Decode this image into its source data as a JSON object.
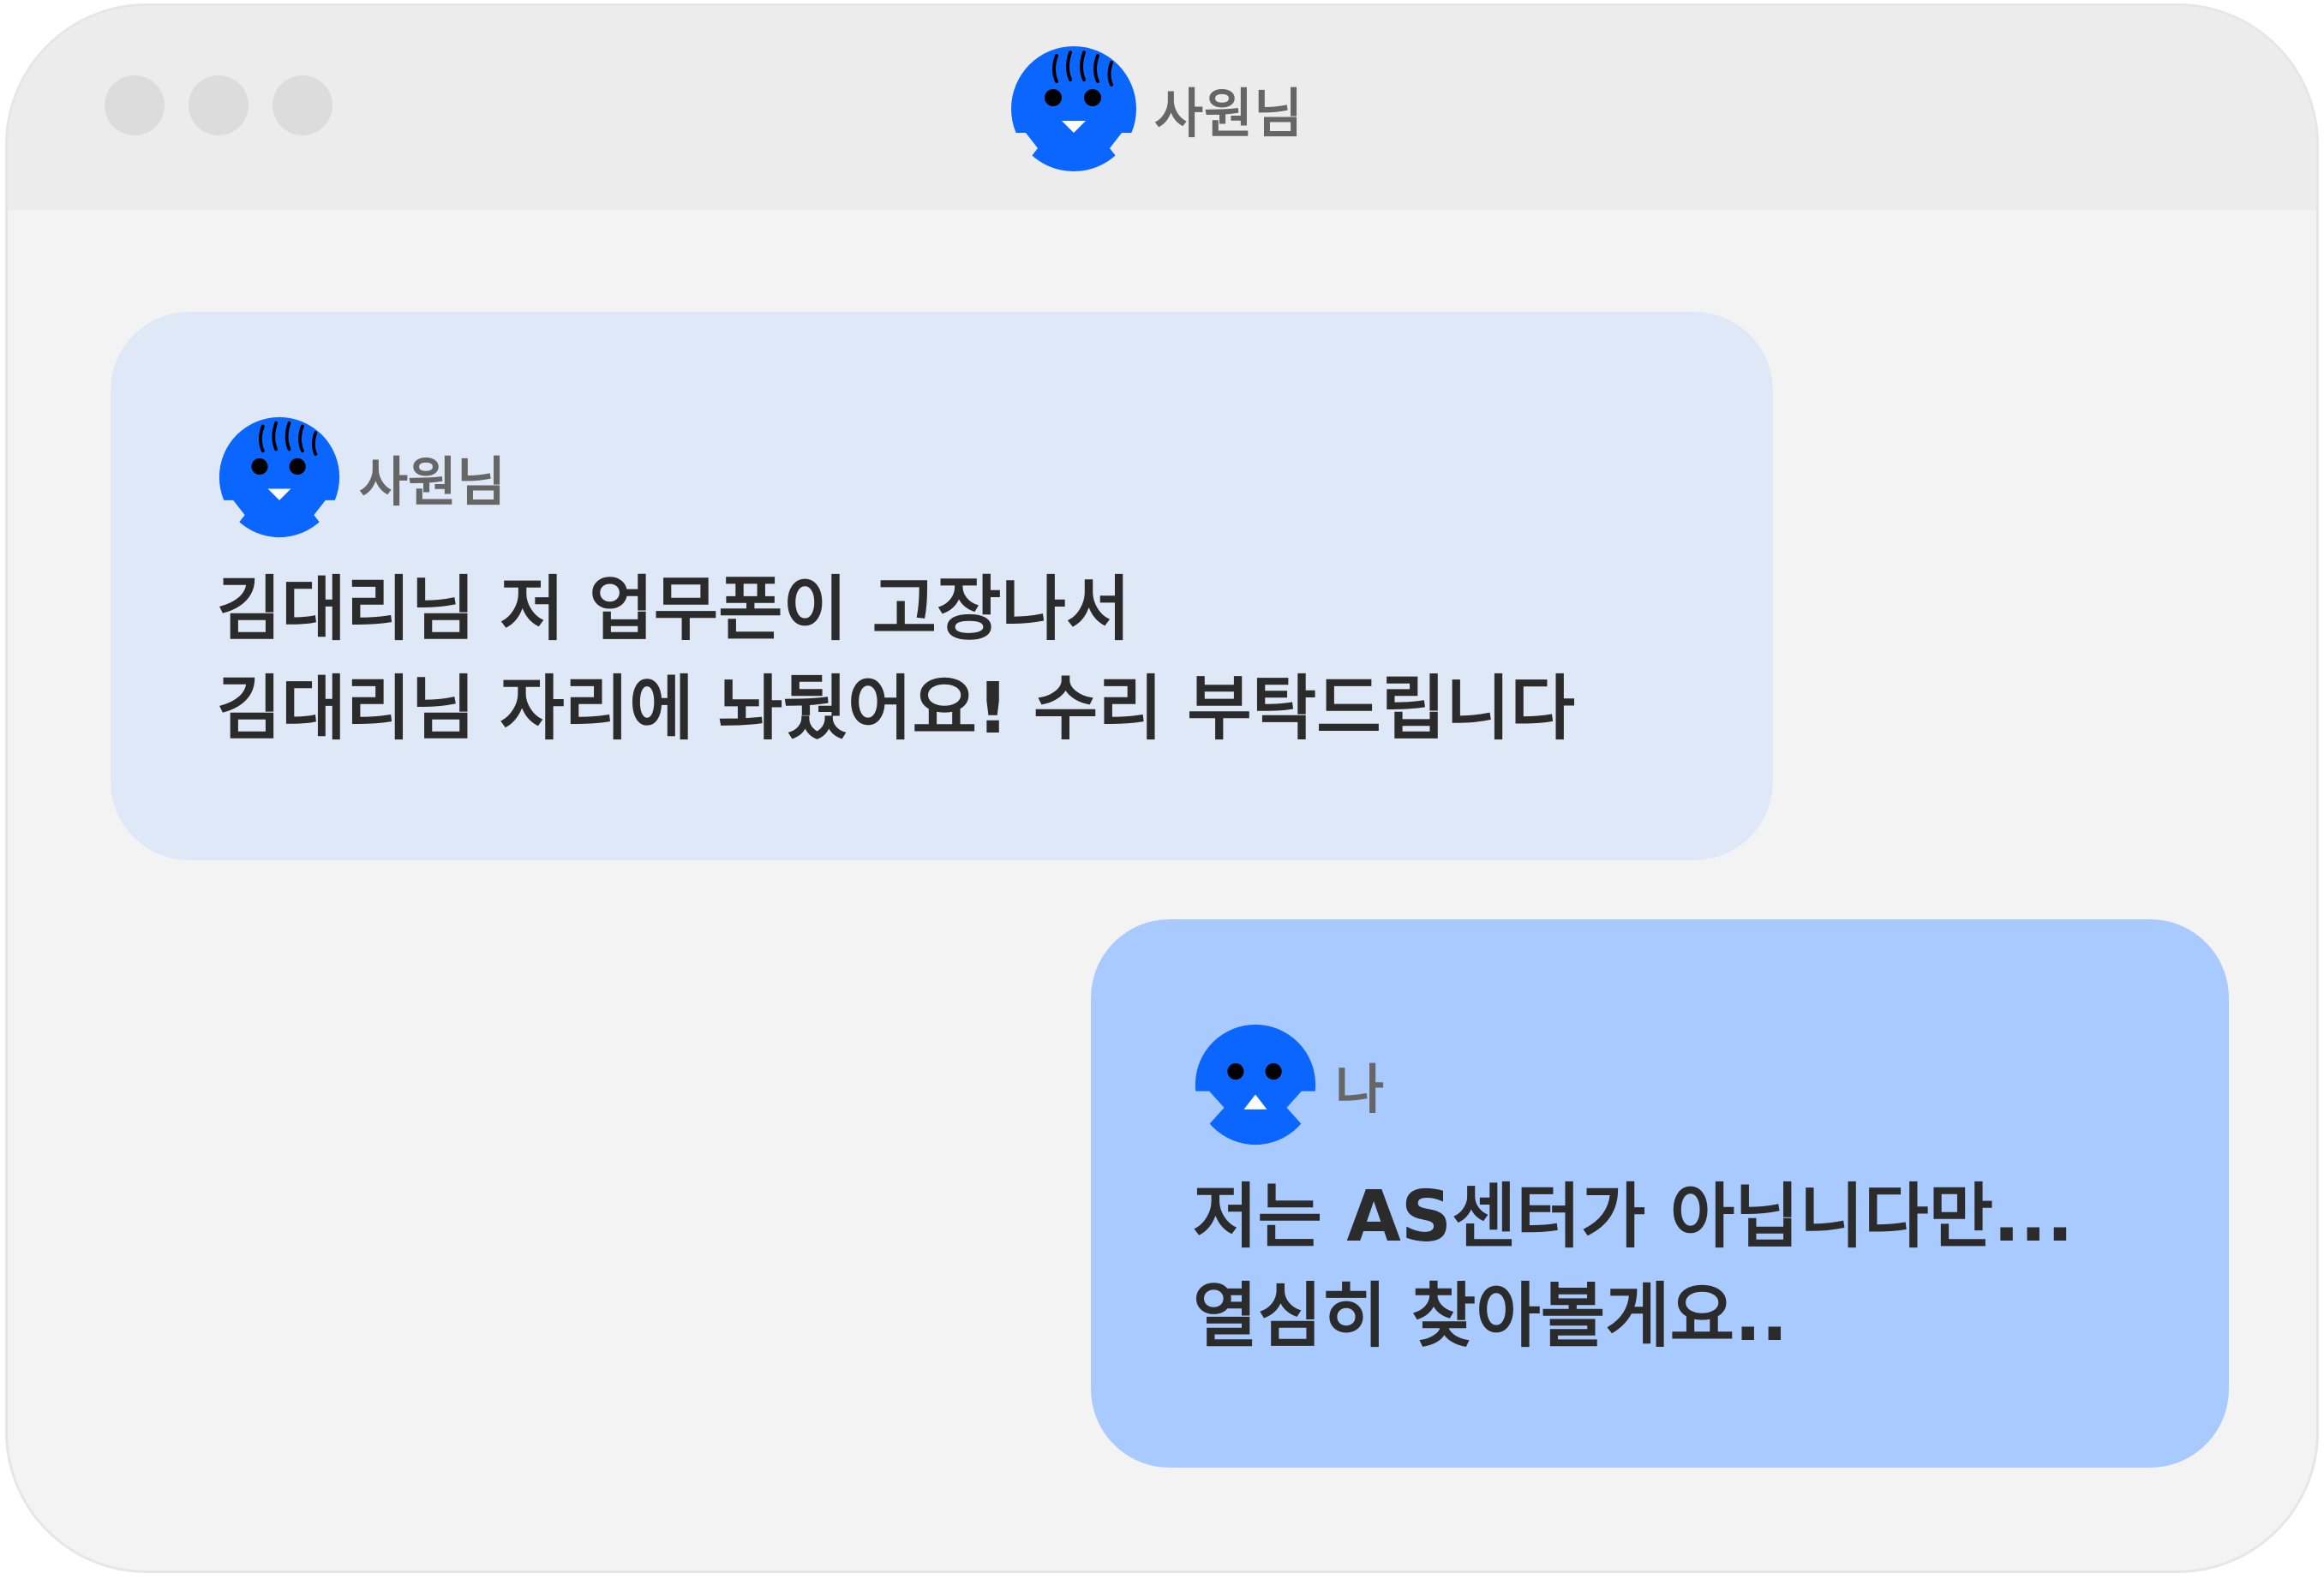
{
  "window": {
    "title": "사원님",
    "title_avatar_icon": "employee-avatar-icon",
    "controls": [
      "window-dot-icon",
      "window-dot-icon",
      "window-dot-icon"
    ]
  },
  "messages": [
    {
      "sender": "사원님",
      "avatar_icon": "employee-avatar-icon",
      "lines": [
        "김대리님 저 업무폰이 고장나서",
        "김대리님 자리에 놔뒀어요! 수리 부탁드립니다"
      ]
    },
    {
      "sender": "나",
      "avatar_icon": "me-avatar-icon",
      "lines": [
        "저는 AS센터가 아닙니다만...",
        "열심히 찾아볼게요.."
      ]
    }
  ],
  "colors": {
    "window_bg": "#f3f3f3",
    "titlebar_bg": "#ececec",
    "incoming_bubble": "#dfe8f6",
    "outgoing_bubble": "#a8caff",
    "avatar_blue": "#0a66ff",
    "text_dark": "#2b2b2b",
    "text_muted": "#666666"
  }
}
